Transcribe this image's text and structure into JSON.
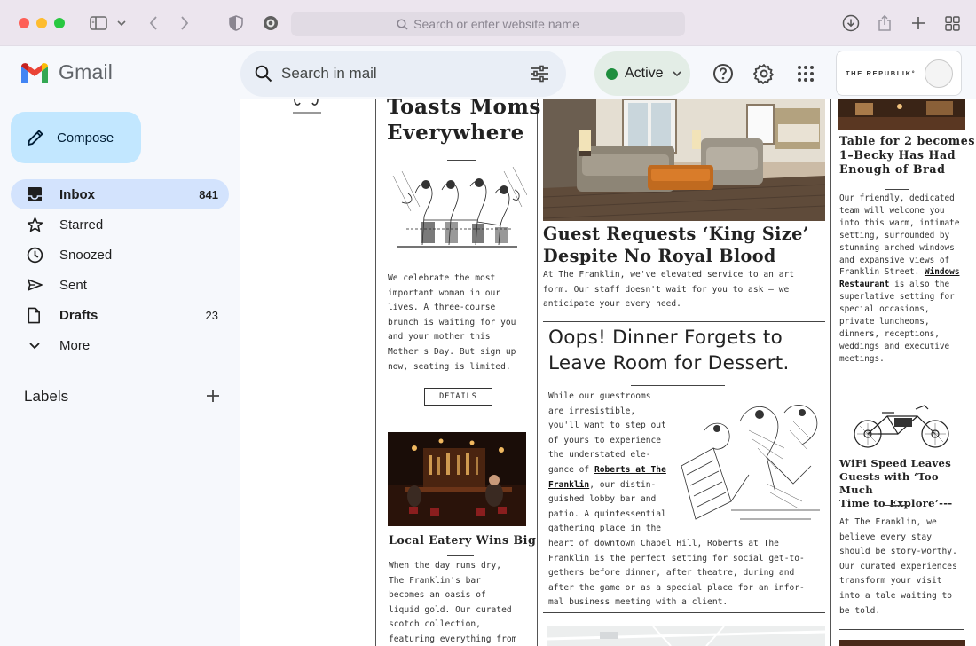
{
  "browser": {
    "url_placeholder": "Search or enter website name"
  },
  "gmail": {
    "logo_text": "Gmail",
    "search_placeholder": "Search in mail",
    "status_label": "Active",
    "brand_name": "THE REPUBLIK°"
  },
  "sidebar": {
    "compose_label": "Compose",
    "items": [
      {
        "label": "Inbox",
        "count": "841"
      },
      {
        "label": "Starred",
        "count": ""
      },
      {
        "label": "Snoozed",
        "count": ""
      },
      {
        "label": "Sent",
        "count": ""
      },
      {
        "label": "Drafts",
        "count": "23"
      },
      {
        "label": "More",
        "count": ""
      }
    ],
    "labels_title": "Labels"
  },
  "email": {
    "col1": {
      "headline": [
        "Toasts Moms",
        "Everywhere"
      ],
      "body": [
        "We celebrate the most",
        "important woman in our",
        "lives. A three-course",
        "brunch is waiting for you",
        "and your mother this",
        "Mother's Day. But sign up",
        "now, seating is limited."
      ],
      "details_label": "DETAILS",
      "headline2": "Local Eatery Wins Big",
      "body2": [
        "When the day runs dry,",
        "The Franklin's bar",
        "becomes an oasis of",
        "liquid gold. Our curated",
        "scotch collection,",
        "featuring everything from"
      ]
    },
    "col2": {
      "headline": [
        "Guest Requests ‘King Size’",
        "Despite No Royal Blood"
      ],
      "body": [
        "At The Franklin, we've elevated service to an art",
        "form. Our staff doesn't wait for you to ask – we",
        "anticipate your every need."
      ],
      "headline2": [
        "Oops! Dinner Forgets to",
        "Leave Room for Dessert."
      ],
      "body2_top": [
        "While our guestrooms",
        "are irresistible,",
        "you'll want to step out",
        "of yours to experience",
        "the understated ele-",
        "gance of "
      ],
      "body2_link1": "Roberts at The",
      "body2_link2": "Franklin",
      "body2_after_link": ", our distin-",
      "body2_mid": [
        "guished lobby bar and",
        "patio. A quintessential",
        "gathering place in the"
      ],
      "body2_wide": [
        "heart of downtown Chapel Hill, Roberts at The",
        "Franklin is the perfect setting for social get-to-",
        "gethers before dinner, after theatre, during and",
        "after the game or as a special place for an infor-",
        "mal business meeting with a client."
      ]
    },
    "col3": {
      "headline": [
        "Table for 2 becomes",
        "1–Becky Has Had",
        "Enough of Brad"
      ],
      "body_lines": [
        "Our friendly, dedicated",
        "team will welcome you",
        "into this warm, intimate",
        "setting, surrounded by",
        "stunning arched windows",
        "and expansive views of",
        "Franklin Street. "
      ],
      "body_link1": "Windows",
      "body_link2": "Restaurant",
      "body_after_link": " is also the",
      "body_tail": [
        "superlative setting for",
        "special occasions,",
        "private luncheons,",
        "dinners, receptions,",
        "weddings and executive",
        "meetings."
      ],
      "headline2": [
        "WiFi Speed Leaves",
        "Guests with ‘Too Much",
        "Time to Explore’---"
      ],
      "body2": [
        "At The Franklin, we",
        "believe every stay",
        "should be story-worthy.",
        "Our curated experiences",
        "transform your visit",
        "into a tale waiting to",
        "be told."
      ]
    }
  },
  "colors": {
    "compose_bg": "#c2e7ff",
    "selected_bg": "#d3e3fd",
    "active_dot": "#1e8e3e",
    "search_bg": "#e9eef6"
  }
}
